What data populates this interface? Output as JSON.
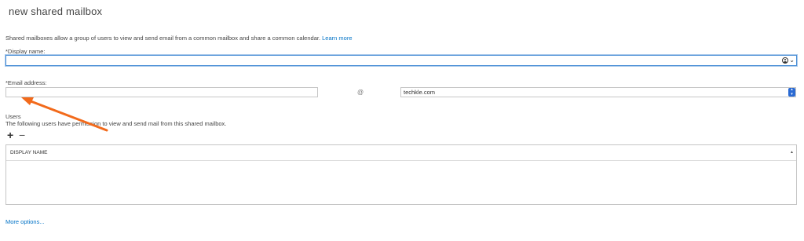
{
  "dialog": {
    "title": "new shared mailbox",
    "intro_text": "Shared mailboxes allow a group of users to view and send email from a common mailbox and share a common calendar.",
    "learn_more": "Learn more"
  },
  "display_name": {
    "label": "*Display name:",
    "value": ""
  },
  "email": {
    "label": "*Email address:",
    "value": "",
    "at": "@",
    "domain": "techkle.com"
  },
  "users": {
    "title": "Users",
    "description": "The following users have permission to view and send mail from this shared mailbox.",
    "add_symbol": "+",
    "remove_symbol": "−",
    "table": {
      "column": "DISPLAY NAME",
      "sort_symbol": "▲",
      "rows": []
    }
  },
  "footer": {
    "more_options": "More options..."
  },
  "colors": {
    "link": "#0072c6",
    "focus_border": "#4a8fd6",
    "annotation_arrow": "#f26a1b",
    "select_button": "#2a6ad3"
  }
}
